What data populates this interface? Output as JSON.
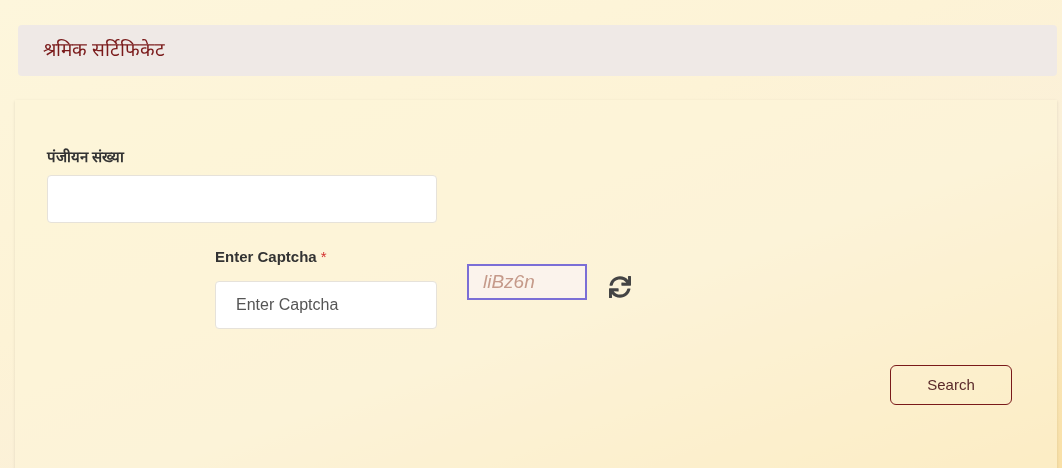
{
  "header": {
    "title": "श्रमिक सर्टिफिकेट"
  },
  "registration_field": {
    "label": "पंजीयन संख्या"
  },
  "captcha": {
    "label": "Enter Captcha",
    "required_mark": "*",
    "placeholder": "Enter Captcha",
    "code": "liBz6n"
  },
  "search_button": {
    "label": "Search"
  }
}
